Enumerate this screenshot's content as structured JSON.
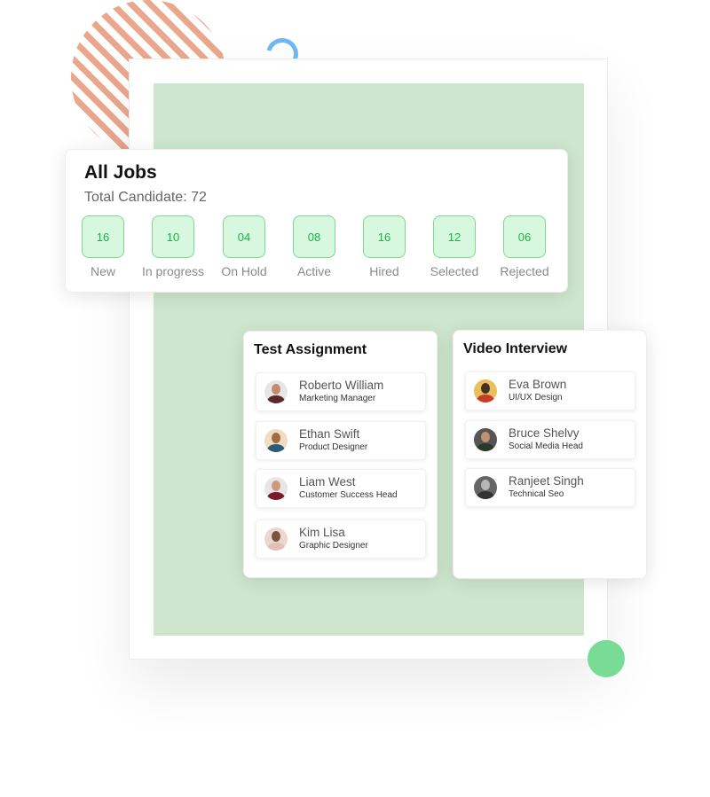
{
  "all_jobs": {
    "title": "All Jobs",
    "total": "Total Candidate: 72",
    "stats": [
      {
        "value": "16",
        "label": "New"
      },
      {
        "value": "10",
        "label": "In progress"
      },
      {
        "value": "04",
        "label": "On Hold"
      },
      {
        "value": "08",
        "label": "Active"
      },
      {
        "value": "16",
        "label": "Hired"
      },
      {
        "value": "12",
        "label": "Selected"
      },
      {
        "value": "06",
        "label": "Rejected"
      }
    ]
  },
  "test_assignment": {
    "title": "Test Assignment",
    "people": [
      {
        "name": "Roberto William",
        "role": "Marketing Manager"
      },
      {
        "name": "Ethan Swift",
        "role": "Product Designer"
      },
      {
        "name": "Liam West",
        "role": "Customer Success Head"
      },
      {
        "name": "Kim Lisa",
        "role": "Graphic Designer"
      }
    ]
  },
  "video_interview": {
    "title": "Video Interview",
    "people": [
      {
        "name": "Eva Brown",
        "role": "UI/UX Design"
      },
      {
        "name": "Bruce Shelvy",
        "role": "Social Media Head"
      },
      {
        "name": "Ranjeet Singh",
        "role": "Technical Seo"
      }
    ]
  },
  "colors": {
    "stat_fill": "#d7f8df",
    "stat_border": "#7cd795",
    "stat_text": "#1bb14a",
    "frame_fill": "#cde6cd"
  }
}
